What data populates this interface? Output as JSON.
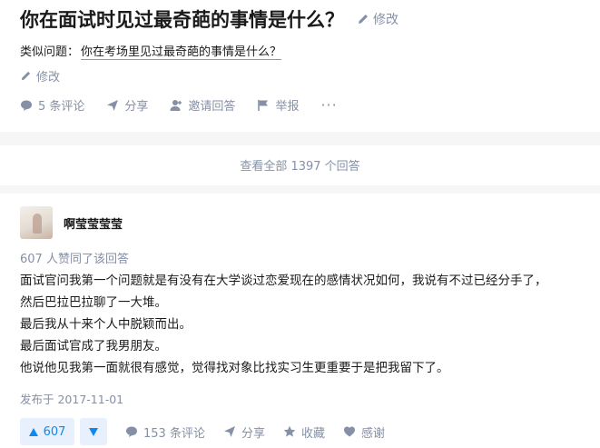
{
  "question": {
    "title": "你在面试时见过最奇葩的事情是什么？",
    "edit_label": "修改",
    "similar_prefix": "类似问题：",
    "similar_link": "你在考场里见过最奇葩的事情是什么？",
    "edit2_label": "修改",
    "actions": {
      "comments": "5 条评论",
      "share": "分享",
      "invite": "邀请回答",
      "report": "举报",
      "more": "···"
    }
  },
  "view_all": "查看全部 1397 个回答",
  "answer": {
    "author": "啊莹莹莹莹",
    "vote_summary": "607 人赞同了该回答",
    "paragraphs": [
      "面试官问我第一个问题就是有没有在大学谈过恋爱现在的感情状况如何，我说有不过已经分手了，",
      "然后巴拉巴拉聊了一大堆。",
      "最后我从十来个人中脱颖而出。",
      "最后面试官成了我男朋友。",
      "他说他见我第一面就很有感觉，觉得找对象比找实习生更重要于是把我留下了。"
    ],
    "published": "发布于 2017-11-01",
    "upvotes": "607",
    "comments": "153 条评论",
    "share": "分享",
    "favorite": "收藏",
    "thanks": "感谢"
  },
  "colors": {
    "accent": "#0f88eb",
    "muted": "#8590a6",
    "vote_bg": "#e8f0fe"
  }
}
